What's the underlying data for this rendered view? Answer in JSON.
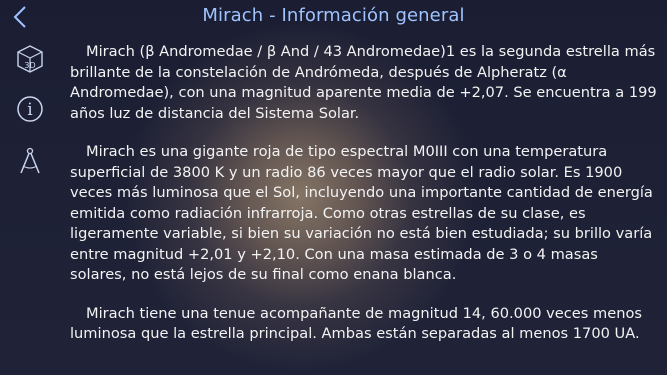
{
  "header": {
    "title": "Mirach - Información general",
    "back_icon": "chevron-left-icon"
  },
  "sidebar": {
    "items": [
      {
        "icon": "3d-cube-icon",
        "label": "3D"
      },
      {
        "icon": "info-icon",
        "label": "i"
      },
      {
        "icon": "compass-icon"
      }
    ]
  },
  "content": {
    "paragraphs": [
      "Mirach (β Andromedae / β And / 43 Andromedae)1 es la segunda estrella más brillante de la constelación de Andrómeda, después de Alpheratz (α Andromedae), con una magnitud aparente media de +2,07. Se encuentra a 199 años luz de distancia del Sistema Solar.",
      "Mirach es una gigante roja de tipo espectral M0III con una temperatura superficial de 3800 K y un radio 86 veces mayor que el radio solar. Es 1900 veces más luminosa que el Sol, incluyendo una importante cantidad de energía emitida como radiación infrarroja. Como otras estrellas de su clase, es ligeramente variable, si bien su variación no está bien estudiada; su brillo varía entre magnitud +2,01 y +2,10. Con una masa estimada de 3 o 4 masas solares, no está lejos de su final como enana blanca.",
      "Mirach tiene una tenue acompañante de magnitud 14, 60.000 veces menos luminosa que la estrella principal. Ambas están separadas al menos 1700 UA."
    ]
  },
  "colors": {
    "accent": "#9fc3ff",
    "background": "#1c1f33",
    "icon": "#c9d4ee",
    "text": "#f3f3f3"
  }
}
